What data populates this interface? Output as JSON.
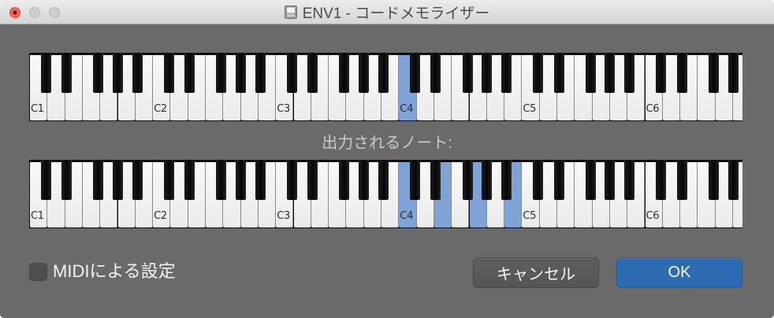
{
  "window": {
    "title": "ENV1 - コードメモライザー",
    "proxy_icon": "document-icon"
  },
  "chord_keyboard": {
    "octave_labels": [
      "C1",
      "C2",
      "C3",
      "C4",
      "C5",
      "C6"
    ],
    "highlighted_midi_notes": [
      60
    ]
  },
  "output_label": "出力されるノート:",
  "output_keyboard": {
    "octave_labels": [
      "C1",
      "C2",
      "C3",
      "C4",
      "C5",
      "C6"
    ],
    "highlighted_midi_notes": [
      60,
      64,
      67,
      71
    ]
  },
  "footer": {
    "midi_checkbox_label": "MIDIによる設定",
    "midi_checkbox_checked": false,
    "cancel_label": "キャンセル",
    "ok_label": "OK"
  },
  "colors": {
    "window_background": "#6a6a6a",
    "key_highlight": "#7fa3d6",
    "ok_button": "#2d6cb3",
    "close_button": "#fe5f57"
  }
}
